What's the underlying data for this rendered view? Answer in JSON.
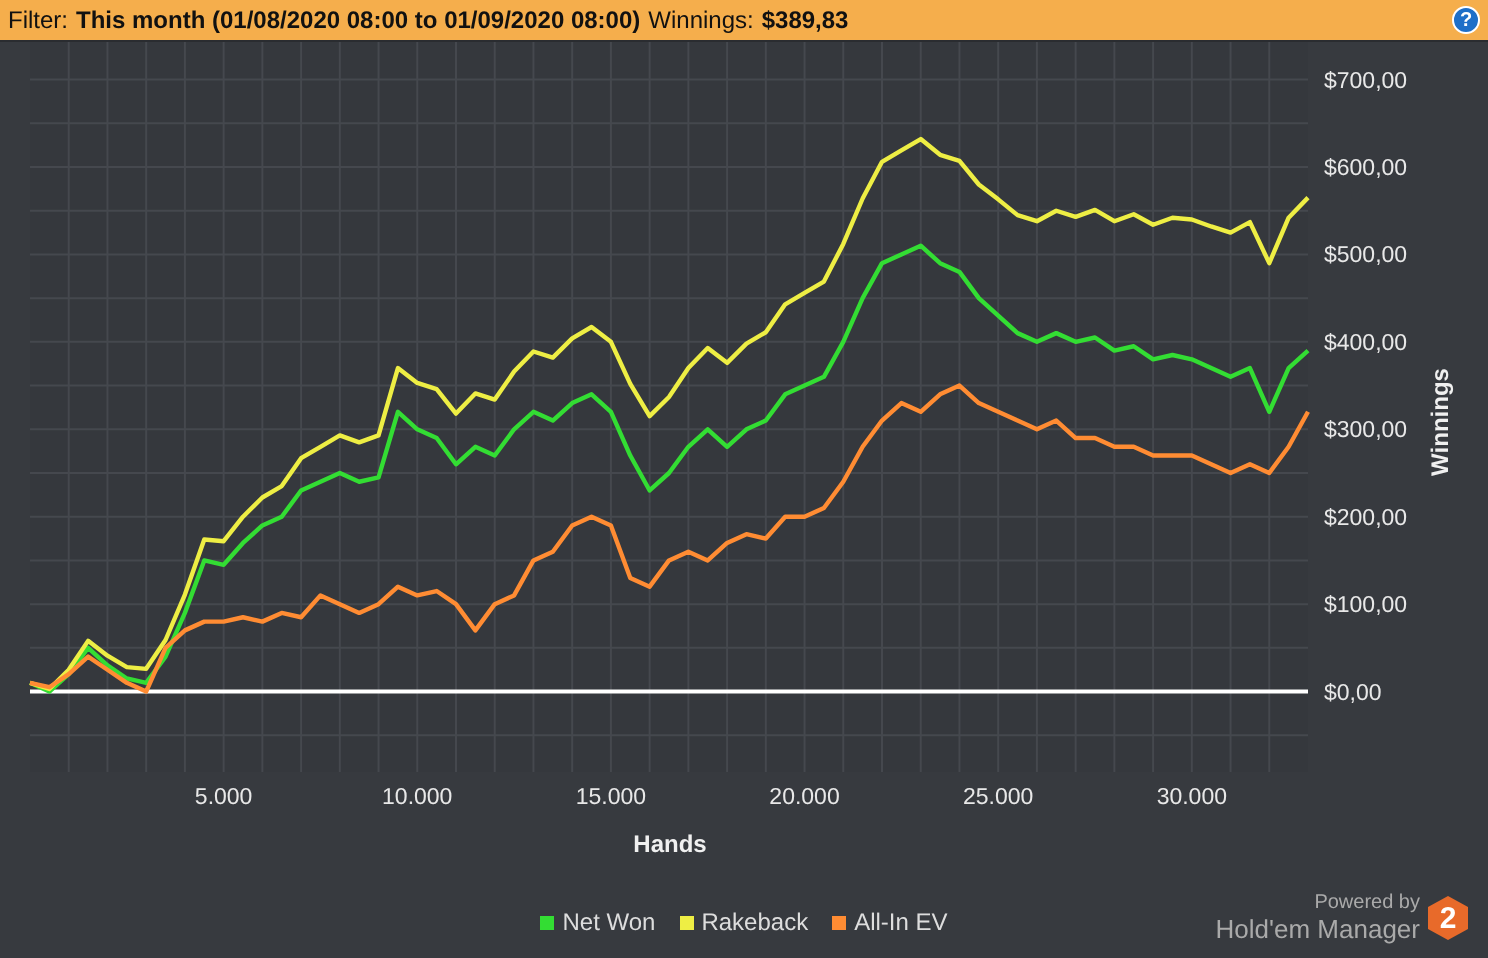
{
  "filter_bar": {
    "filter_label": "Filter:",
    "filter_value": "This month (01/08/2020 08:00 to 01/09/2020 08:00)",
    "winnings_label": "Winnings:",
    "winnings_value": "$389,83",
    "help_button": "?"
  },
  "chart": {
    "chart_data": {
      "type": "line",
      "xlabel": "Hands",
      "ylabel": "Winnings",
      "x": [
        0,
        500,
        1000,
        1500,
        2000,
        2500,
        3000,
        3500,
        4000,
        4500,
        5000,
        5500,
        6000,
        6500,
        7000,
        7500,
        8000,
        8500,
        9000,
        9500,
        10000,
        10500,
        11000,
        11500,
        12000,
        12500,
        13000,
        13500,
        14000,
        14500,
        15000,
        15500,
        16000,
        16500,
        17000,
        17500,
        18000,
        18500,
        19000,
        19500,
        20000,
        20500,
        21000,
        21500,
        22000,
        22500,
        23000,
        23500,
        24000,
        24500,
        25000,
        25500,
        26000,
        26500,
        27000,
        27500,
        28000,
        28500,
        29000,
        29500,
        30000,
        30500,
        31000,
        31500,
        32000,
        32500,
        33000
      ],
      "series": [
        {
          "name": "Net Won",
          "color": "#33dd33",
          "values": [
            10,
            0,
            20,
            50,
            30,
            15,
            10,
            40,
            90,
            150,
            145,
            170,
            190,
            200,
            230,
            240,
            250,
            240,
            245,
            320,
            300,
            290,
            260,
            280,
            270,
            300,
            320,
            310,
            330,
            340,
            320,
            270,
            230,
            250,
            280,
            300,
            280,
            300,
            310,
            340,
            350,
            360,
            400,
            450,
            490,
            500,
            510,
            490,
            480,
            450,
            430,
            410,
            400,
            410,
            400,
            405,
            390,
            395,
            380,
            385,
            380,
            370,
            360,
            370,
            320,
            370,
            390
          ]
        },
        {
          "name": "Rakeback",
          "color": "#eeee44",
          "values": [
            10,
            3,
            25,
            58,
            41,
            28,
            26,
            59,
            111,
            174,
            172,
            200,
            222,
            235,
            267,
            280,
            293,
            285,
            293,
            370,
            353,
            346,
            318,
            341,
            334,
            366,
            389,
            382,
            404,
            417,
            400,
            352,
            315,
            337,
            370,
            393,
            376,
            398,
            411,
            443,
            456,
            469,
            512,
            564,
            606,
            619,
            632,
            614,
            607,
            580,
            563,
            545,
            538,
            550,
            543,
            551,
            538,
            546,
            534,
            542,
            540,
            532,
            525,
            537,
            490,
            542,
            565
          ]
        },
        {
          "name": "All-In EV",
          "color": "#ff8c33",
          "values": [
            10,
            5,
            20,
            40,
            25,
            10,
            0,
            50,
            70,
            80,
            80,
            85,
            80,
            90,
            85,
            110,
            100,
            90,
            100,
            120,
            110,
            115,
            100,
            70,
            100,
            110,
            150,
            160,
            190,
            200,
            190,
            130,
            120,
            150,
            160,
            150,
            170,
            180,
            175,
            200,
            200,
            210,
            240,
            280,
            310,
            330,
            320,
            340,
            350,
            330,
            320,
            310,
            300,
            310,
            290,
            290,
            280,
            280,
            270,
            270,
            270,
            260,
            250,
            260,
            250,
            280,
            320
          ]
        }
      ],
      "grid": true,
      "xlim": [
        0,
        33000
      ],
      "ylim": [
        -92,
        743
      ],
      "xticks": [
        {
          "value": 5000,
          "label": "5.000"
        },
        {
          "value": 10000,
          "label": "10.000"
        },
        {
          "value": 15000,
          "label": "15.000"
        },
        {
          "value": 20000,
          "label": "20.000"
        },
        {
          "value": 25000,
          "label": "25.000"
        },
        {
          "value": 30000,
          "label": "30.000"
        }
      ],
      "yticks": [
        {
          "value": 0,
          "label": "$0,00"
        },
        {
          "value": 100,
          "label": "$100,00"
        },
        {
          "value": 200,
          "label": "$200,00"
        },
        {
          "value": 300,
          "label": "$300,00"
        },
        {
          "value": 400,
          "label": "$400,00"
        },
        {
          "value": 500,
          "label": "$500,00"
        },
        {
          "value": 600,
          "label": "$600,00"
        },
        {
          "value": 700,
          "label": "$700,00"
        }
      ]
    }
  },
  "branding": {
    "powered_by": "Powered by",
    "product": "Hold'em Manager",
    "version_badge": "2"
  }
}
